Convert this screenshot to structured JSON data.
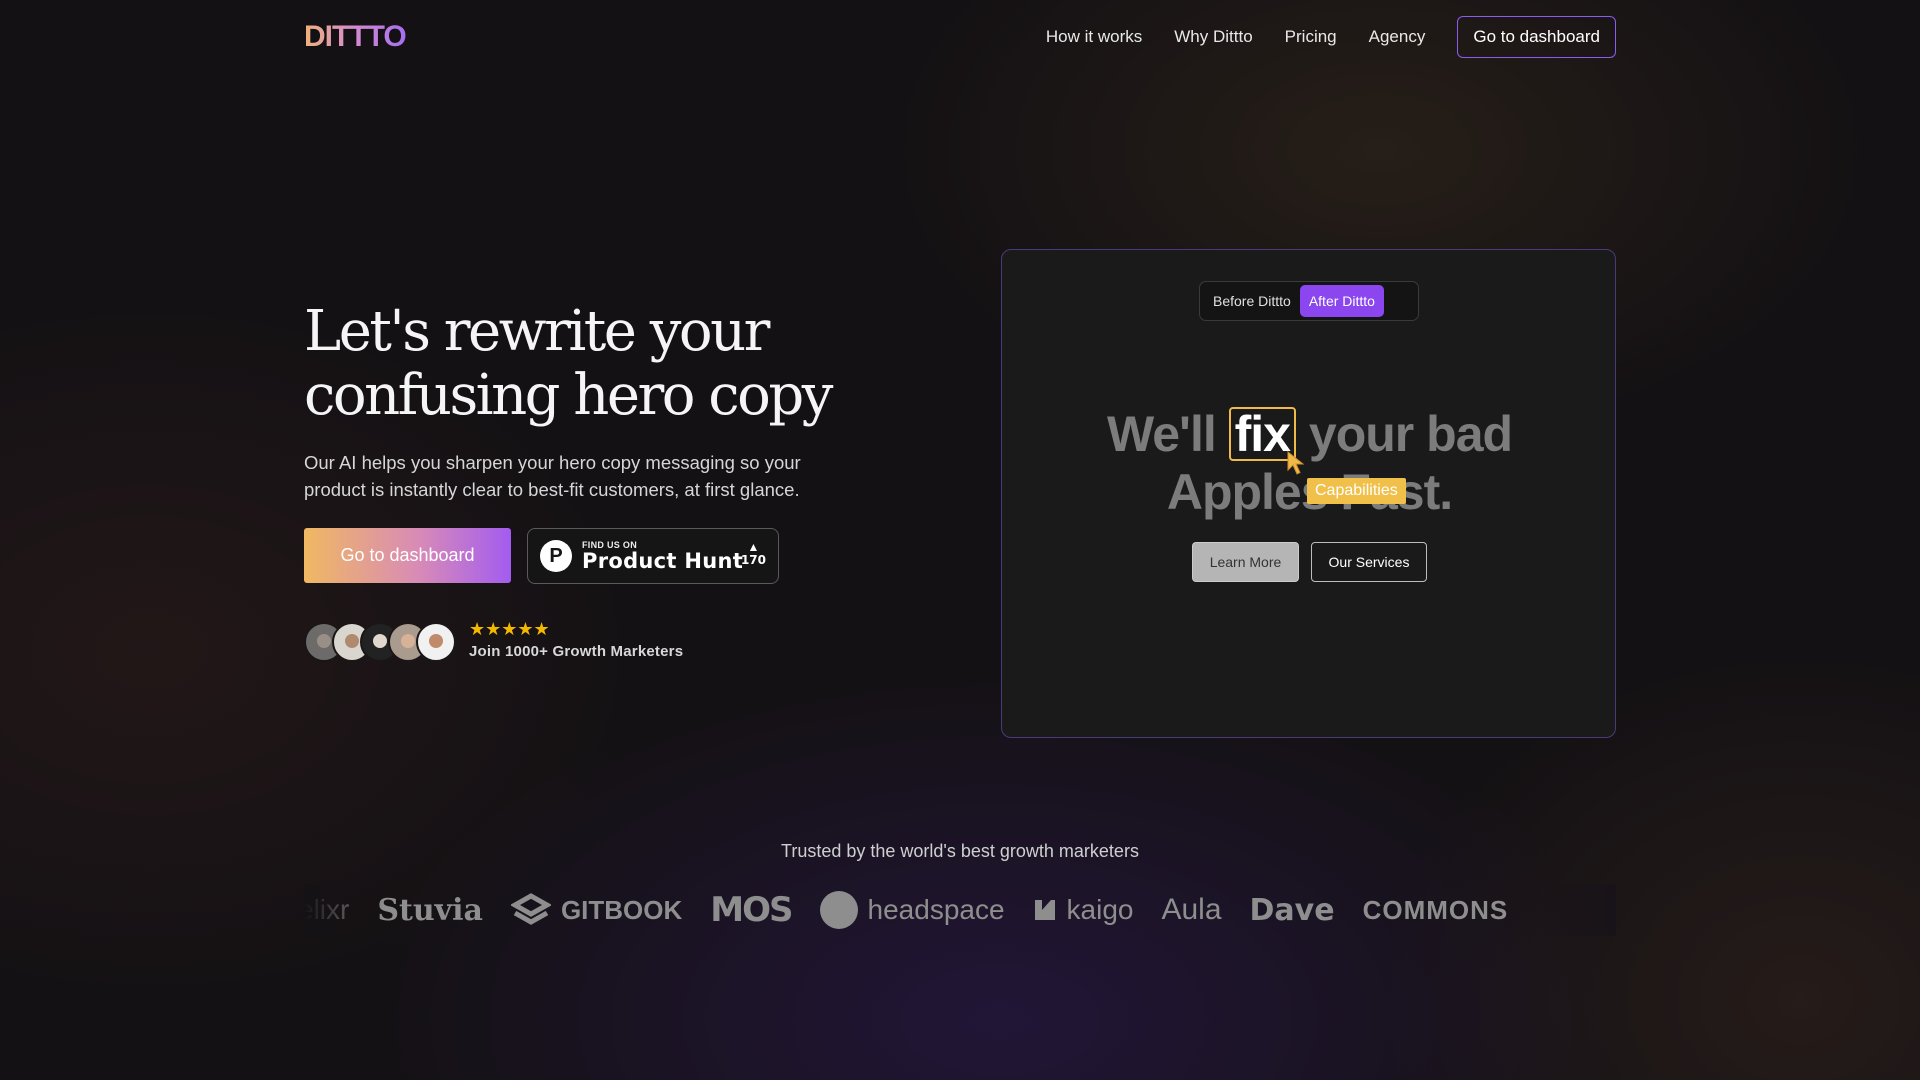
{
  "nav": {
    "logo": "DITTTO",
    "links": [
      "How it works",
      "Why Dittto",
      "Pricing",
      "Agency"
    ],
    "cta": "Go to dashboard"
  },
  "hero": {
    "title_line1": "Let's rewrite your",
    "title_line2": "confusing hero copy",
    "subtitle": "Our AI helps you sharpen your hero copy messaging so your product is instantly clear to best-fit customers, at first glance.",
    "cta": "Go to dashboard",
    "product_hunt": {
      "small": "FIND US ON",
      "big": "Product Hunt",
      "votes": "170",
      "letter": "P",
      "arrow": "▲"
    },
    "social": {
      "stars": "★★★★★",
      "text": "Join 1000+ Growth Marketers"
    }
  },
  "demo": {
    "toggle": [
      "Before Dittto",
      "After Dittto"
    ],
    "active_toggle": "After Dittto",
    "line1_pre": "We'll",
    "line1_fix": "fix",
    "line1_post": "your bad",
    "line2": "Apples Fast.",
    "badge": "Capabilities",
    "btn_primary": "Learn More",
    "btn_secondary": "Our Services"
  },
  "trusted": {
    "heading": "Trusted by the world's best growth marketers",
    "logos": [
      "elixr",
      "Stuvia",
      "GITBOOK",
      "MOS",
      "headspace",
      "kaigo",
      "Aula",
      "Dave",
      "COMMONS"
    ]
  },
  "colors": {
    "accent_purple": "#8b46f0",
    "accent_gold": "#f0b94a"
  }
}
